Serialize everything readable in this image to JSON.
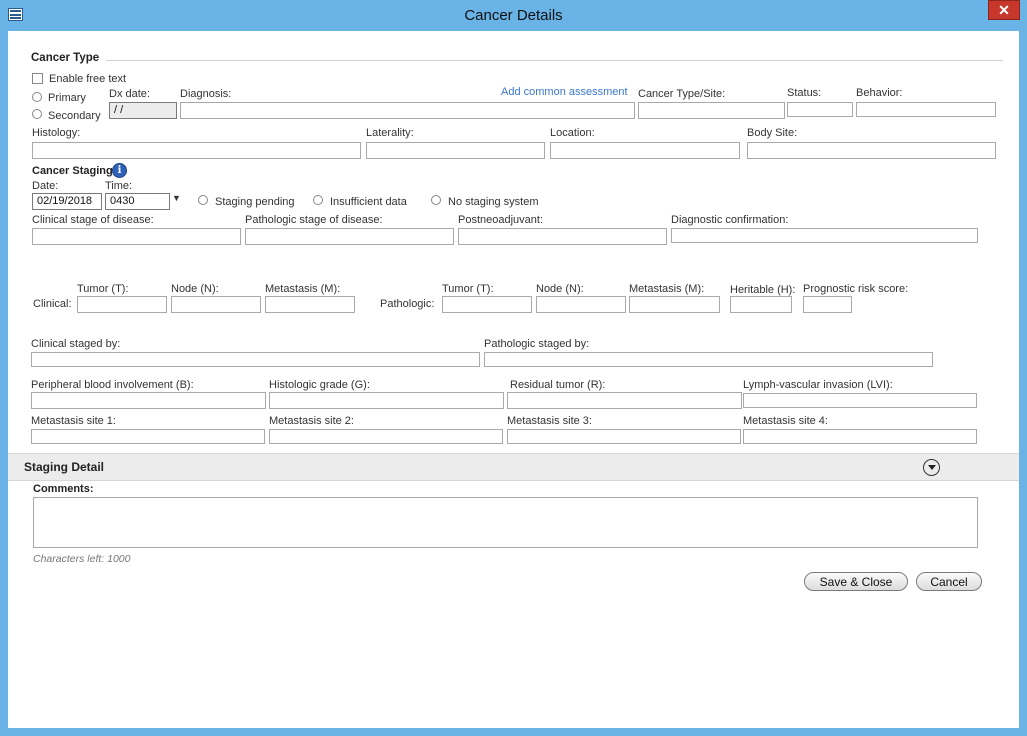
{
  "window": {
    "title": "Cancer Details",
    "close_glyph": "✕"
  },
  "cancer_type": {
    "heading": "Cancer Type",
    "enable_free_text": "Enable free text",
    "primary": "Primary",
    "secondary": "Secondary",
    "dx_date_label": "Dx date:",
    "dx_date_value": " /  /",
    "diagnosis_label": "Diagnosis:",
    "add_common_assessment": "Add common assessment",
    "cancer_type_site_label": "Cancer Type/Site:",
    "status_label": "Status:",
    "behavior_label": "Behavior:",
    "histology_label": "Histology:",
    "laterality_label": "Laterality:",
    "location_label": "Location:",
    "body_site_label": "Body Site:"
  },
  "cancer_staging": {
    "heading": "Cancer Staging",
    "date_label": "Date:",
    "date_value": "02/19/2018",
    "time_label": "Time:",
    "time_value": "0430",
    "staging_pending": "Staging pending",
    "insufficient_data": "Insufficient data",
    "no_staging_system": "No staging system",
    "clinical_stage": "Clinical stage of disease:",
    "pathologic_stage": "Pathologic stage of disease:",
    "postneoadjuvant": "Postneoadjuvant:",
    "diagnostic_confirmation": "Diagnostic confirmation:",
    "clinical": "Clinical:",
    "pathologic": "Pathologic:",
    "tumor": "Tumor (T):",
    "node": "Node (N):",
    "metastasis": "Metastasis (M):",
    "heritable": "Heritable (H):",
    "prognostic_risk": "Prognostic risk score:",
    "clinical_staged_by": "Clinical staged by:",
    "pathologic_staged_by": "Pathologic staged by:",
    "peripheral_blood": "Peripheral blood involvement (B):",
    "histologic_grade": "Histologic grade (G):",
    "residual_tumor": "Residual tumor (R):",
    "lymph_vascular": "Lymph-vascular invasion (LVI):",
    "met_site_1": "Metastasis site 1:",
    "met_site_2": "Metastasis site 2:",
    "met_site_3": "Metastasis site 3:",
    "met_site_4": "Metastasis site 4:"
  },
  "staging_detail": {
    "heading": "Staging Detail"
  },
  "comments": {
    "label": "Comments:",
    "chars_left": "Characters left: 1000"
  },
  "buttons": {
    "save_close": "Save & Close",
    "cancel": "Cancel"
  },
  "icons": {
    "info": "i",
    "dropdown": "▼"
  },
  "colors": {
    "titlebar": "#69b3e7",
    "close": "#c7372b",
    "link": "#3a78c9",
    "info": "#2e63b8"
  }
}
